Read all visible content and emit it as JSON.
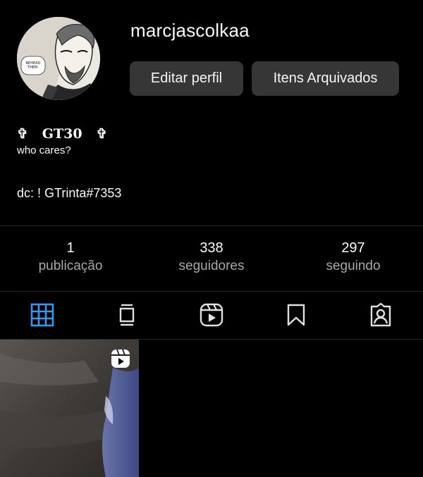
{
  "profile": {
    "username": "marcjascolkaa",
    "avatar_icon": "manga-avatar-image",
    "avatar_text": "BEHEAD THEM."
  },
  "actions": {
    "edit_label": "Editar perfil",
    "archive_label": "Itens Arquivados"
  },
  "bio": {
    "name": "✞   GT30   ✞",
    "tagline": "who cares?",
    "contact": "dc: ! GTrinta#7353"
  },
  "stats": [
    {
      "value": "1",
      "label": "publicação"
    },
    {
      "value": "338",
      "label": "seguidores"
    },
    {
      "value": "297",
      "label": "seguindo"
    }
  ],
  "tabs": [
    {
      "icon": "grid-icon",
      "active": true,
      "color": "#3797f0"
    },
    {
      "icon": "igtv-icon",
      "active": false
    },
    {
      "icon": "reels-icon",
      "active": false
    },
    {
      "icon": "saved-icon",
      "active": false
    },
    {
      "icon": "tagged-icon",
      "active": false
    }
  ],
  "posts": [
    {
      "type": "reel",
      "badge_icon": "reel-badge-icon"
    }
  ],
  "colors": {
    "background": "#000000",
    "button": "#363636",
    "muted_text": "#a8a8a8",
    "accent": "#3797f0",
    "divider": "#262626"
  }
}
